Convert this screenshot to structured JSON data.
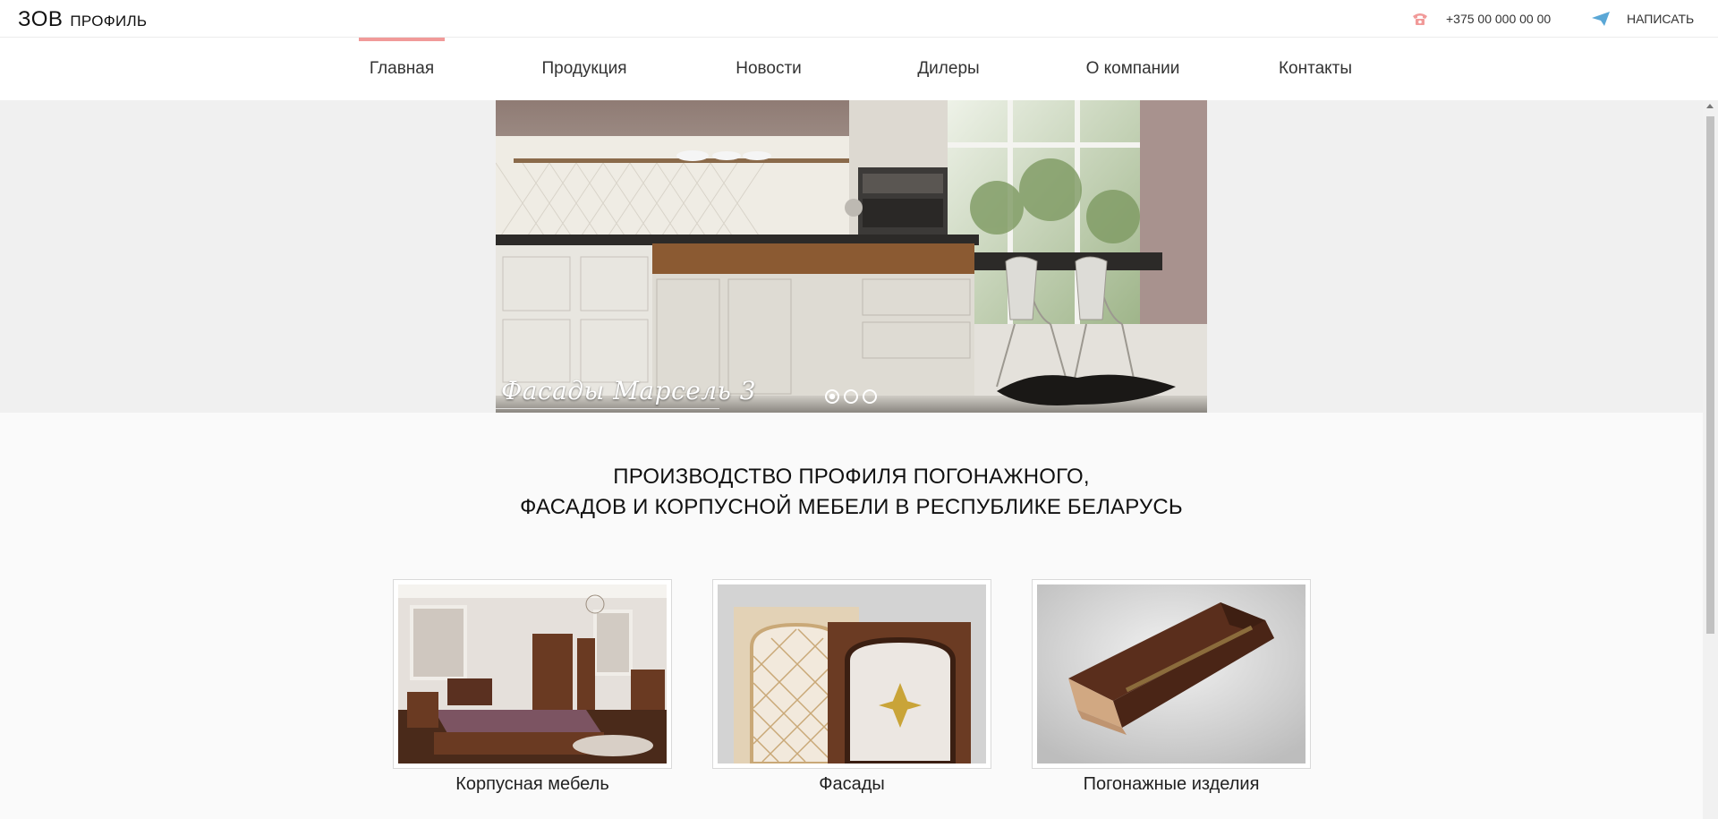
{
  "header": {
    "logo_main": "ЗОВ",
    "logo_sub": "ПРОФИЛЬ",
    "phone": "+375 00 000 00 00",
    "write_label": "НАПИСАТЬ",
    "phone_icon": "phone-icon",
    "write_icon": "paper-plane-icon",
    "accent_color": "#f19a99"
  },
  "nav": {
    "items": [
      {
        "label": "Главная",
        "active": true
      },
      {
        "label": "Продукция"
      },
      {
        "label": "Новости"
      },
      {
        "label": "Дилеры"
      },
      {
        "label": "О компании"
      },
      {
        "label": "Контакты"
      }
    ]
  },
  "hero": {
    "caption": "Фасады Марсель 3",
    "slides_count": 3,
    "active_slide": 1
  },
  "headline": {
    "line1": "ПРОИЗВОДСТВО ПРОФИЛЯ ПОГОНАЖНОГО,",
    "line2": "ФАСАДОВ И КОРПУСНОЙ МЕБЕЛИ В РЕСПУБЛИКЕ БЕЛАРУСЬ"
  },
  "cards": [
    {
      "label": "Корпусная мебель"
    },
    {
      "label": "Фасады"
    },
    {
      "label": "Погонажные изделия"
    }
  ]
}
